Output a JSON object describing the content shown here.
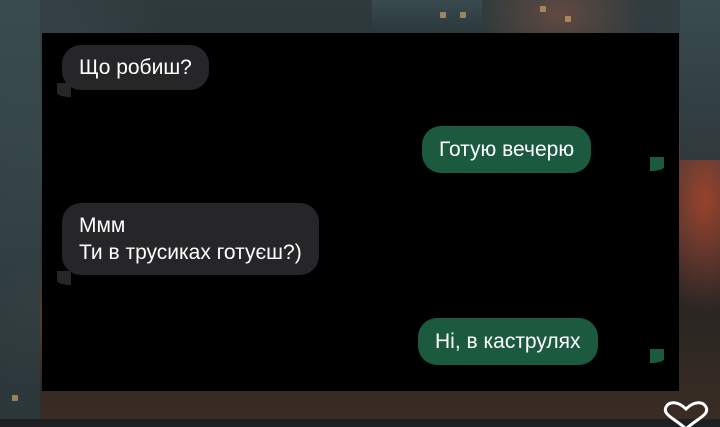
{
  "conversation": {
    "messages": [
      {
        "direction": "incoming",
        "lines": [
          "Що робиш?"
        ]
      },
      {
        "direction": "outgoing",
        "lines": [
          "Готую вечерю"
        ]
      },
      {
        "direction": "incoming",
        "lines": [
          "Ммм",
          "Ти в трусиках готуєш?)"
        ]
      },
      {
        "direction": "outgoing",
        "lines": [
          "Ні, в каструлях"
        ]
      }
    ]
  },
  "colors": {
    "incoming_bubble": "#262628",
    "outgoing_bubble": "#1c5a3f",
    "panel": "#000000",
    "text": "#ffffff"
  },
  "decoration": {
    "corner_icon": "heart-outline-icon"
  }
}
